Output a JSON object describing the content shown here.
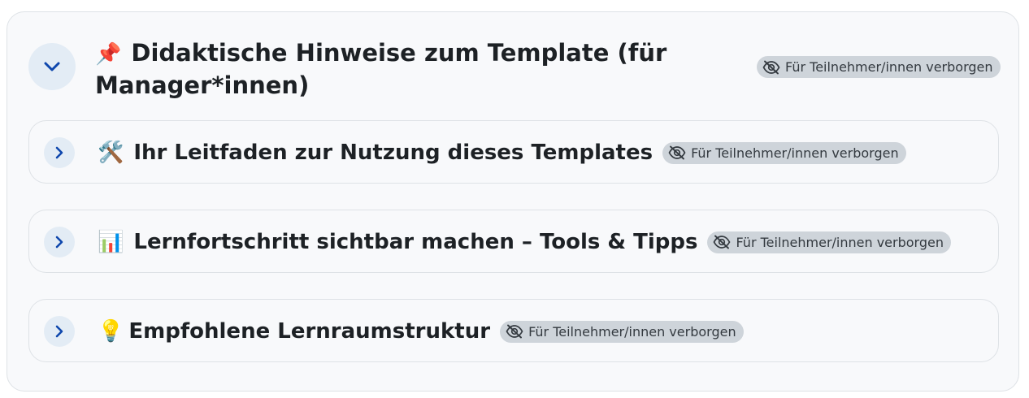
{
  "main_section": {
    "emoji": "📌",
    "title": "Didaktische Hinweise zum Template (für Manager*innen)",
    "badge": "Für Teilnehmer/innen verborgen"
  },
  "subsections": [
    {
      "emoji": "🛠️",
      "title": "Ihr Leitfaden zur Nutzung dieses Templates",
      "badge": "Für Teilnehmer/innen verborgen"
    },
    {
      "emoji": "📊",
      "title": "Lernfortschritt sichtbar machen – Tools & Tipps",
      "badge": "Für Teilnehmer/innen verborgen"
    },
    {
      "emoji": "💡",
      "title": "Empfohlene Lernraumstruktur",
      "badge": "Für Teilnehmer/innen verborgen"
    }
  ],
  "colors": {
    "toggle_bg": "#e3ecf5",
    "chevron": "#0f47ad",
    "badge_bg": "#ced4da",
    "card_bg": "#f8f9fb"
  }
}
